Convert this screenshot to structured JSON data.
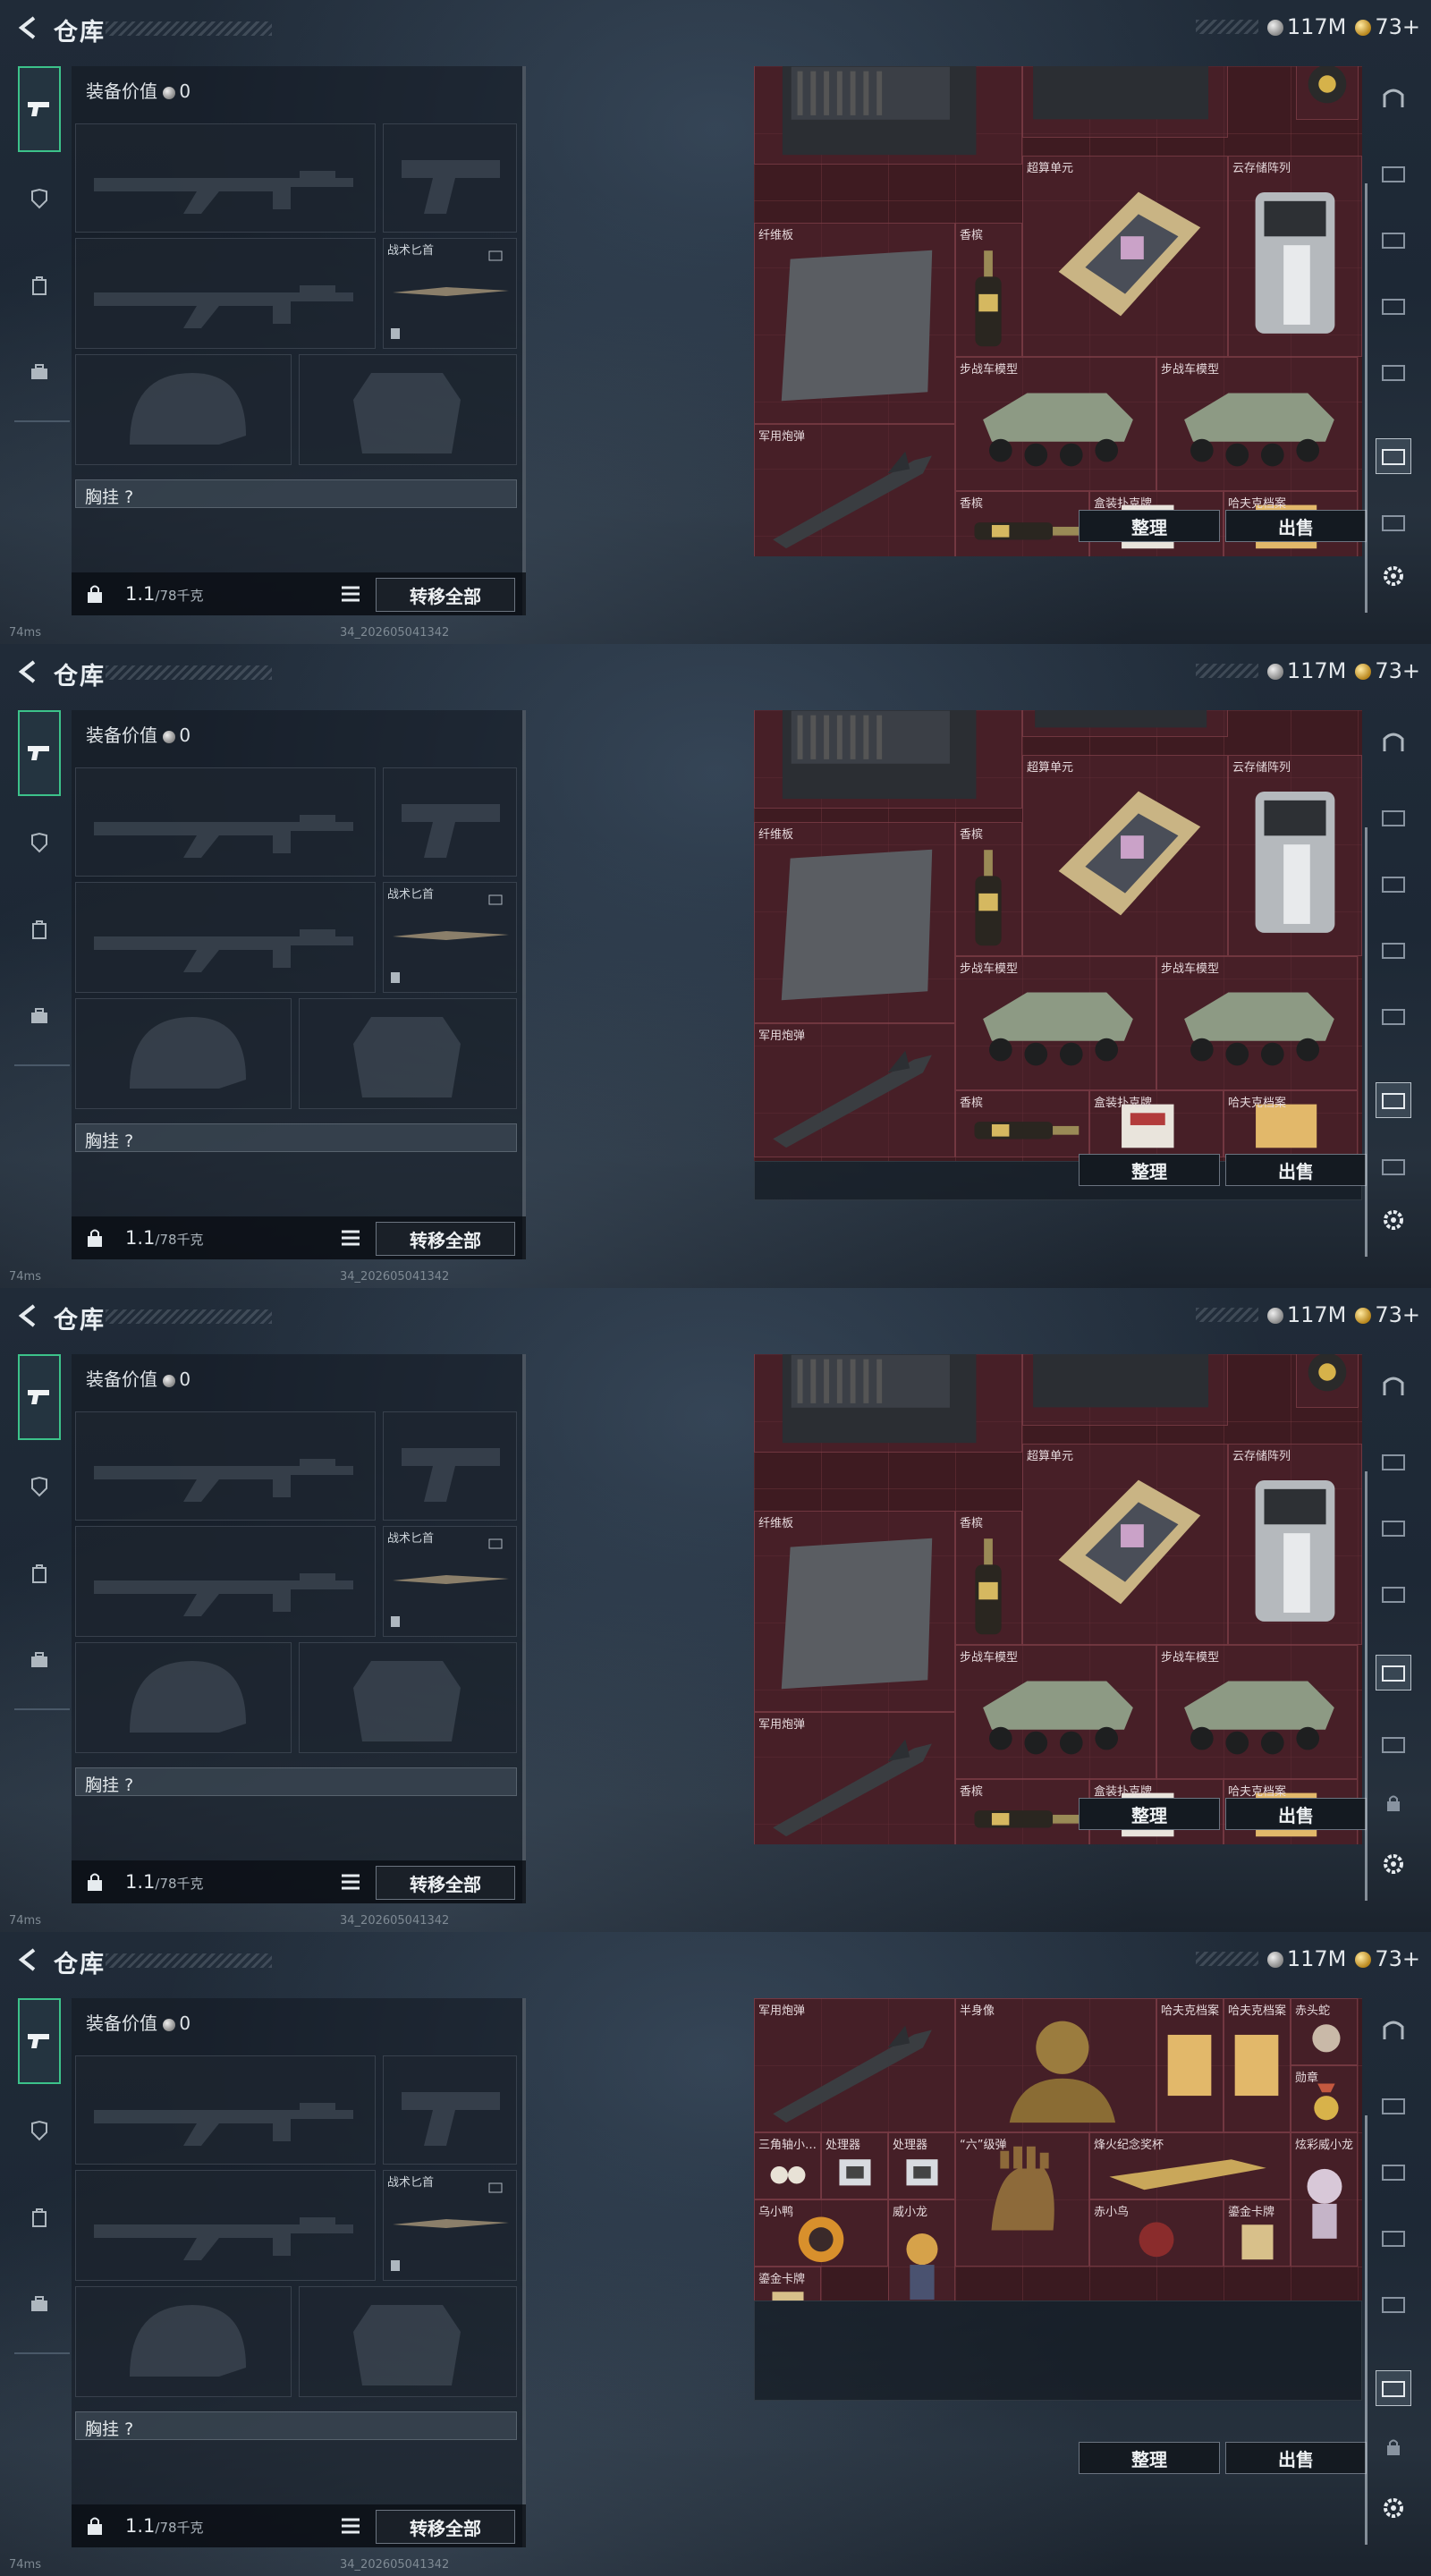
{
  "header": {
    "title": "仓库",
    "currency_silver": "117M",
    "currency_gold": "73+"
  },
  "equipment": {
    "value_label": "装备价值",
    "value_amount": "0",
    "knife_slot_label": "战术匕首",
    "chest_rig_label": "胸挂",
    "chest_rig_value": "?",
    "weight_current": "1.1",
    "weight_max": "/78千克",
    "transfer_all_label": "转移全部"
  },
  "actions": {
    "sort_label": "整理",
    "sell_label": "出售"
  },
  "footer": {
    "ping": "74ms",
    "build": "34_202605041342"
  },
  "stash_a": {
    "labels": {
      "super_unit": "超算单元",
      "cloud_array": "云存储阵列",
      "fiber_board": "纤维板",
      "champagne": "香槟",
      "ifv_model": "步战车模型",
      "missile": "军用炮弹",
      "boxed_poker": "盒装扑克牌",
      "harf_file": "哈夫克档案"
    }
  },
  "stash_b": {
    "labels": {
      "missile": "军用炮弹",
      "bust": "半身像",
      "harf_file": "哈夫克档案",
      "red_mid": "赤头蛇",
      "badge": "勋章",
      "triangle": "三角轴小…",
      "processor": "处理器",
      "six_bomb": "“六”级弹",
      "torch_award": "烽火纪念奖杯",
      "colorful_toy": "炫彩威小龙",
      "red_bird": "乌小鸭",
      "dragon": "威小龙",
      "red_small": "赤小鸟",
      "gold_card": "鎏金卡牌"
    }
  },
  "colors": {
    "accent": "#3cc28a",
    "stash_bg": "#3e1b21",
    "panel_bg": "#1d2835"
  }
}
